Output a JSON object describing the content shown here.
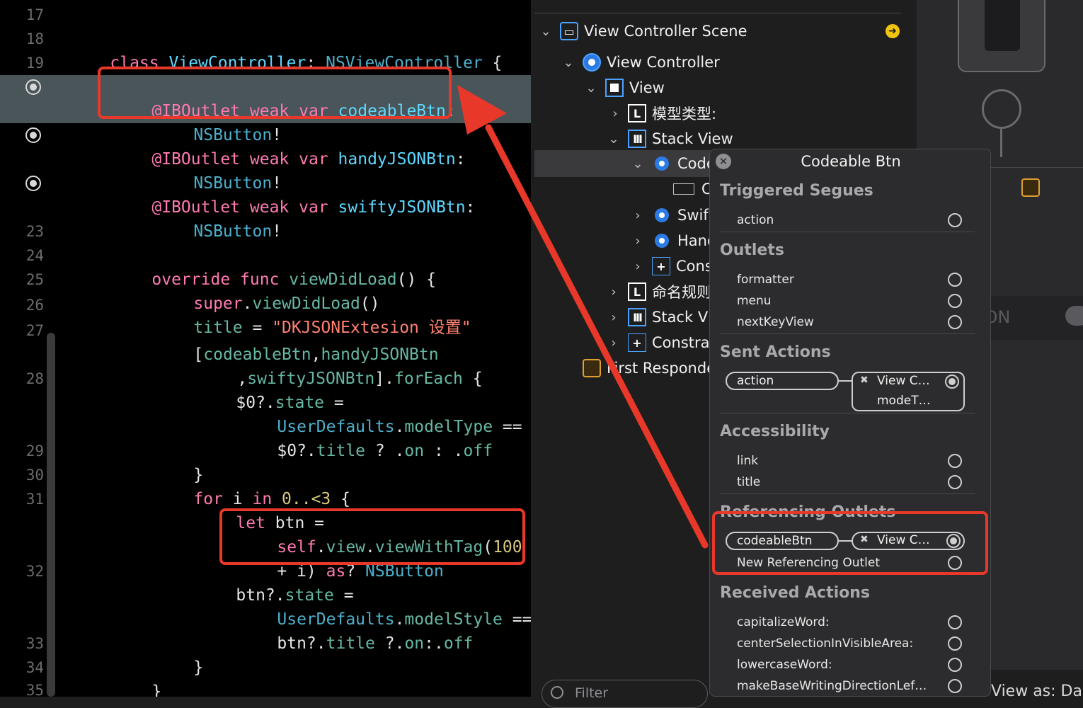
{
  "editor": {
    "line_numbers": [
      "17",
      "18",
      "19",
      "",
      "",
      "",
      "",
      "",
      "23",
      "24",
      "25",
      "26",
      "27",
      "28",
      "29",
      "30",
      "31",
      "32",
      "33",
      "34",
      "35"
    ],
    "lines": {
      "l18": {
        "kw": "class",
        "name": "ViewController",
        "colon": ":",
        "super": "NSViewController",
        "brace": "{"
      },
      "l20a": {
        "attr": "@IBOutlet",
        "weak": "weak",
        "var": "var",
        "name": "codeableBtn",
        "colon": ":"
      },
      "l20b": {
        "type": "NSButton",
        "bang": "!"
      },
      "l21a": {
        "attr": "@IBOutlet",
        "weak": "weak",
        "var": "var",
        "name": "handyJSONBtn",
        "colon": ":"
      },
      "l21b": {
        "type": "NSButton",
        "bang": "!"
      },
      "l22a": {
        "attr": "@IBOutlet",
        "weak": "weak",
        "var": "var",
        "name": "swiftyJSONBtn",
        "colon": ":"
      },
      "l22b": {
        "type": "NSButton",
        "bang": "!"
      },
      "l24": {
        "override": "override",
        "func": "func",
        "name": "viewDidLoad",
        "rest": "() {"
      },
      "l25": {
        "super": "super",
        "dot": ".",
        "call": "viewDidLoad",
        "rest": "()"
      },
      "l26": {
        "title": "title",
        "eq": " = ",
        "str": "\"DKJSONExtesion 设置\""
      },
      "l27a": {
        "open": "[",
        "a": "codeableBtn",
        "comma": ",",
        "b": "handyJSONBtn"
      },
      "l27b": {
        "comma": ",",
        "c": "swiftyJSONBtn",
        "close": "].",
        "each": "forEach",
        "brace": " {"
      },
      "l28a": {
        "v": "$0?.",
        "state": "state",
        "eq": " ="
      },
      "l28b": {
        "ud": "UserDefaults",
        "dot": ".",
        "mt": "modelType",
        "eq": " =="
      },
      "l28c": {
        "v": "$0?.",
        "title": "title",
        "q": " ? .",
        "on": "on",
        "c": " : .",
        "off": "off"
      },
      "l29": {
        "brace": "}"
      },
      "l30": {
        "for": "for",
        "i": " i ",
        "in": "in",
        "range": " 0..<3",
        "brace": " {"
      },
      "l31a": {
        "let": "let",
        "rest": " btn ="
      },
      "l31b": {
        "self": "self",
        "dot1": ".",
        "view": "view",
        "dot2": ".",
        "vwt": "viewWithTag",
        "paren": "(",
        "num": "100"
      },
      "l31c": {
        "plus": "+ i) ",
        "as": "as",
        "q": "? ",
        "type": "NSButton"
      },
      "l32a": {
        "v": "btn?.",
        "state": "state",
        "eq": " ="
      },
      "l32b": {
        "ud": "UserDefaults",
        "dot": ".",
        "ms": "modelStyle",
        "eq": " =="
      },
      "l32c": {
        "v": "btn?.",
        "title": "title",
        "q": " ?.",
        "on": "on",
        "c": ":.",
        "off": "off"
      },
      "l33": {
        "brace": "}"
      },
      "l34": {
        "brace": "}"
      }
    }
  },
  "outline": {
    "scene": "View Controller Scene",
    "vc": "View Controller",
    "view": "View",
    "label1": "模型类型:",
    "stack1": "Stack View",
    "codeable": "Codeable Btn",
    "cell": "C",
    "swifty": "Swif",
    "handy": "Hand",
    "constraints_inner": "Cons",
    "label2": "命名规则:",
    "stack2": "Stack V",
    "constraints": "Constra",
    "first_responder": "First Responder",
    "icon_L": "L",
    "icon_bars": "III",
    "icon_cross": "+"
  },
  "canvas": {
    "switch_label": "SwiftyJSON",
    "view_as": "View as: Dark"
  },
  "popover": {
    "title": "Codeable Btn",
    "triggered_segues": "Triggered Segues",
    "action": "action",
    "outlets": "Outlets",
    "formatter": "formatter",
    "menu": "menu",
    "nextKeyView": "nextKeyView",
    "sent_actions": "Sent Actions",
    "sent_action_pill": "action",
    "sent_target_1": "View C…",
    "sent_target_2": "modeT…",
    "accessibility": "Accessibility",
    "link": "link",
    "title_item": "title",
    "referencing_outlets": "Referencing Outlets",
    "ref_pill": "codeableBtn",
    "ref_target": "View C…",
    "new_ref": "New Referencing Outlet",
    "received_actions": "Received Actions",
    "capitalize": "capitalizeWord:",
    "center": "centerSelectionInVisibleArea:",
    "lowercase": "lowercaseWord:",
    "makebase": "makeBaseWritingDirectionLef…"
  },
  "filter": {
    "placeholder": "Filter"
  },
  "colors": {
    "annotation_red": "#e8382a",
    "selection_blue": "#2c7be5"
  }
}
